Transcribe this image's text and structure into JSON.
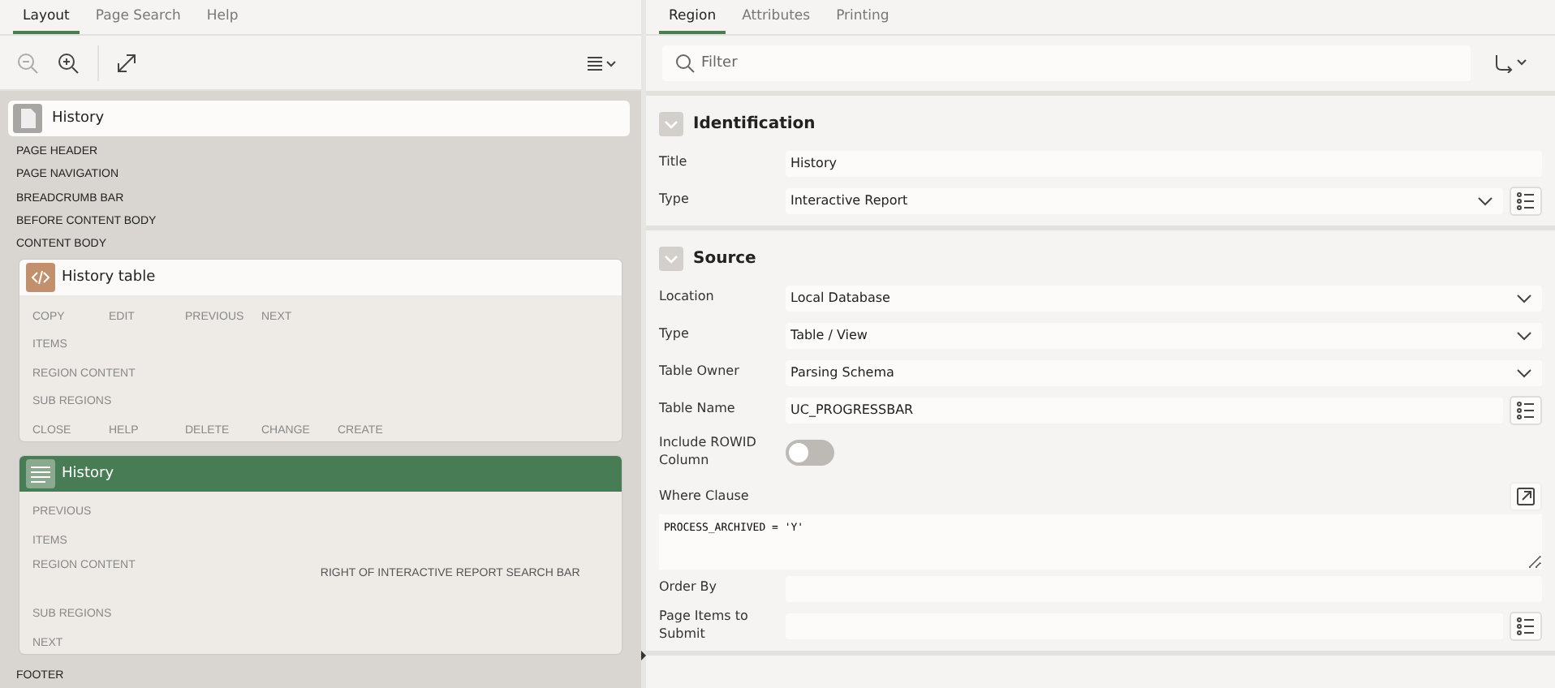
{
  "left_panel": {
    "tabs": [
      {
        "label": "Layout",
        "selected": true
      },
      {
        "label": "Page Search",
        "selected": false
      },
      {
        "label": "Help",
        "selected": false
      }
    ],
    "page": {
      "title": "History",
      "positions": [
        "PAGE HEADER",
        "PAGE NAVIGATION",
        "BREADCRUMB BAR",
        "BEFORE CONTENT BODY",
        "CONTENT BODY"
      ]
    },
    "regions": [
      {
        "title": "History table",
        "kind": "static",
        "selected": false,
        "rows": [
          {
            "labels": [
              "COPY",
              "EDIT",
              "PREVIOUS",
              "NEXT"
            ]
          },
          {
            "labels": [
              "ITEMS"
            ]
          },
          {
            "labels": [
              "REGION CONTENT"
            ]
          },
          {
            "labels": [
              "SUB REGIONS"
            ]
          },
          {
            "labels": [
              "CLOSE",
              "HELP",
              "DELETE",
              "CHANGE",
              "CREATE"
            ]
          }
        ]
      },
      {
        "title": "History",
        "kind": "report",
        "selected": true,
        "rows": [
          {
            "labels": [
              "PREVIOUS"
            ]
          },
          {
            "labels": [
              "ITEMS"
            ]
          },
          {
            "labels": [
              "REGION CONTENT"
            ],
            "aside": "RIGHT OF INTERACTIVE REPORT SEARCH BAR"
          },
          {
            "labels": [
              "SUB REGIONS"
            ]
          },
          {
            "labels": [
              "NEXT"
            ]
          }
        ]
      }
    ],
    "footer": "FOOTER"
  },
  "right_panel": {
    "tabs": [
      {
        "label": "Region",
        "selected": true
      },
      {
        "label": "Attributes",
        "selected": false
      },
      {
        "label": "Printing",
        "selected": false
      }
    ],
    "filter": {
      "placeholder": "Filter"
    },
    "sections": [
      {
        "title": "Identification",
        "expanded": true,
        "fields": [
          {
            "label": "Title",
            "kind": "text",
            "value": "History"
          },
          {
            "label": "Type",
            "kind": "select",
            "value": "Interactive Report",
            "list_button": true
          }
        ]
      },
      {
        "title": "Source",
        "expanded": true,
        "fields": [
          {
            "label": "Location",
            "kind": "select",
            "value": "Local Database"
          },
          {
            "label": "Type",
            "kind": "select",
            "value": "Table / View"
          },
          {
            "label": "Table Owner",
            "kind": "select",
            "value": "Parsing Schema"
          },
          {
            "label": "Table Name",
            "kind": "text",
            "value": "UC_PROGRESSBAR",
            "list_button": true
          },
          {
            "label": "Include ROWID Column",
            "kind": "switch",
            "on": false
          },
          {
            "label": "Where Clause",
            "kind": "code",
            "value": "PROCESS_ARCHIVED = 'Y'"
          },
          {
            "label": "Order By",
            "kind": "text"
          },
          {
            "label": "Page Items to Submit",
            "kind": "text",
            "list_button": true
          }
        ]
      }
    ]
  }
}
